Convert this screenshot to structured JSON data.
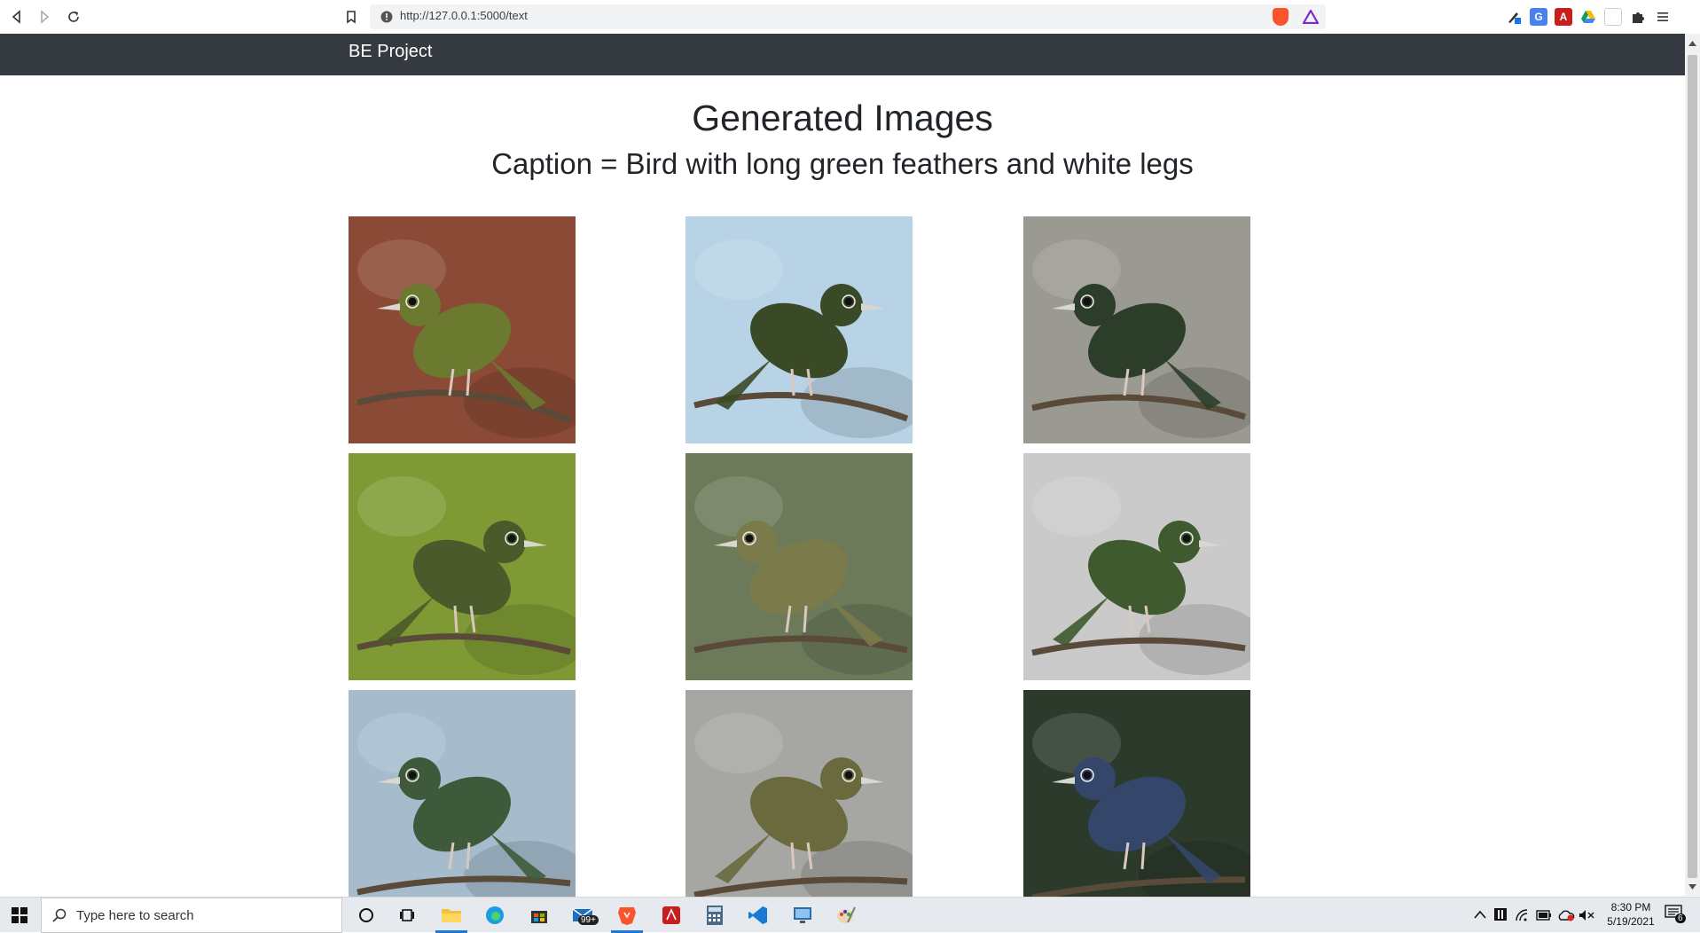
{
  "browser": {
    "url": "http://127.0.0.1:5000/text"
  },
  "navbar": {
    "brand": "BE Project"
  },
  "main": {
    "title": "Generated Images",
    "caption": "Caption = Bird with long green feathers and white legs",
    "images": [
      {
        "name": "generated-bird-1",
        "bg": "#8a4a35",
        "bird": "#6b7a2e"
      },
      {
        "name": "generated-bird-2",
        "bg": "#b9d3e6",
        "bird": "#3a4a26"
      },
      {
        "name": "generated-bird-3",
        "bg": "#9a9a92",
        "bird": "#2c3e2a"
      },
      {
        "name": "generated-bird-4",
        "bg": "#7f9a34",
        "bird": "#4a5a2a"
      },
      {
        "name": "generated-bird-5",
        "bg": "#6d7a5a",
        "bird": "#7a7a4a"
      },
      {
        "name": "generated-bird-6",
        "bg": "#c9cac9",
        "bird": "#3e5a2e"
      },
      {
        "name": "generated-bird-7",
        "bg": "#a6bccd",
        "bird": "#3e5a3a"
      },
      {
        "name": "generated-bird-8",
        "bg": "#a6a6a2",
        "bird": "#6a6a3e"
      },
      {
        "name": "generated-bird-9",
        "bg": "#2c3a2c",
        "bird": "#34466a"
      }
    ]
  },
  "taskbar": {
    "search_placeholder": "Type here to search",
    "mail_badge": "99+",
    "time": "8:30 PM",
    "date": "5/19/2021",
    "notifications": "6"
  },
  "colors": {
    "navbar_bg": "#343a40",
    "taskbar_bg": "#e6eaee",
    "accent_brave": "#fb542b"
  }
}
